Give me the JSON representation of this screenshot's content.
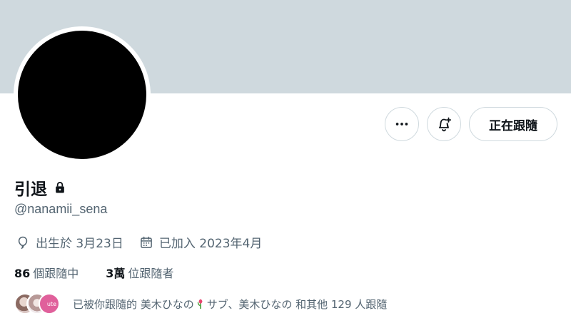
{
  "profile": {
    "display_name": "引退",
    "handle": "@nanamii_sena",
    "birthday": "出生於 3月23日",
    "joined": "已加入 2023年4月"
  },
  "actions": {
    "more_icon": "more-horizontal-icon",
    "bell_icon": "bell-plus-icon",
    "following_label": "正在跟隨"
  },
  "stats": {
    "following_count": "86",
    "following_label": "個跟隨中",
    "followers_count": "3萬",
    "followers_label": "位跟隨者"
  },
  "followed_by": {
    "prefix": "已被你跟隨的 美木ひなの",
    "middle": "サブ、美木ひなの 和其他 129 人跟隨",
    "badge_text": "ute"
  },
  "colors": {
    "banner": "#cfd9de",
    "muted_text": "#536471",
    "primary_text": "#0f1419"
  }
}
